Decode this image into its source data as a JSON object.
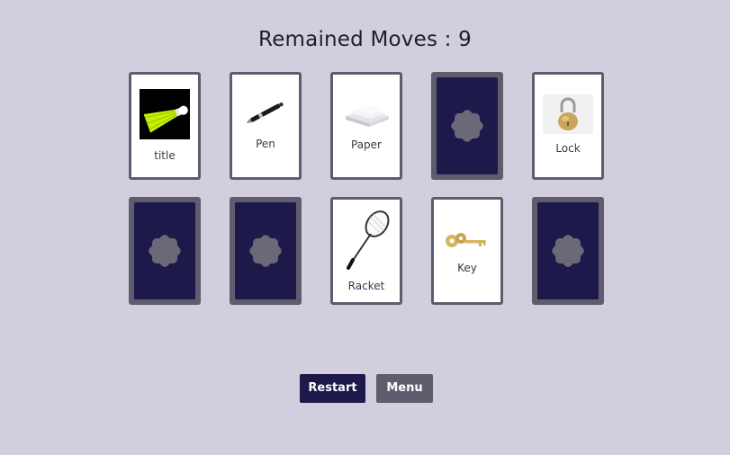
{
  "header": {
    "moves_label": "Remained Moves : 9"
  },
  "cards": [
    {
      "state": "face-up",
      "label": "title",
      "icon": "shuttlecock-icon"
    },
    {
      "state": "face-up",
      "label": "Pen",
      "icon": "pen-icon"
    },
    {
      "state": "face-up",
      "label": "Paper",
      "icon": "paper-icon"
    },
    {
      "state": "face-down",
      "label": "",
      "icon": "card-back-emblem-icon"
    },
    {
      "state": "face-up",
      "label": "Lock",
      "icon": "padlock-icon"
    },
    {
      "state": "face-down",
      "label": "",
      "icon": "card-back-emblem-icon"
    },
    {
      "state": "face-down",
      "label": "",
      "icon": "card-back-emblem-icon"
    },
    {
      "state": "face-up",
      "label": "Racket",
      "icon": "racket-icon"
    },
    {
      "state": "face-up",
      "label": "Key",
      "icon": "key-icon"
    },
    {
      "state": "face-down",
      "label": "",
      "icon": "card-back-emblem-icon"
    }
  ],
  "buttons": {
    "restart_label": "Restart",
    "menu_label": "Menu"
  },
  "colors": {
    "background": "#d3cedd",
    "card_back": "#1d1a4b",
    "card_frame": "#5f5c6d",
    "emblem": "#6b6878",
    "restart_button": "#1d1a4b",
    "menu_button": "#5f5c6d"
  }
}
